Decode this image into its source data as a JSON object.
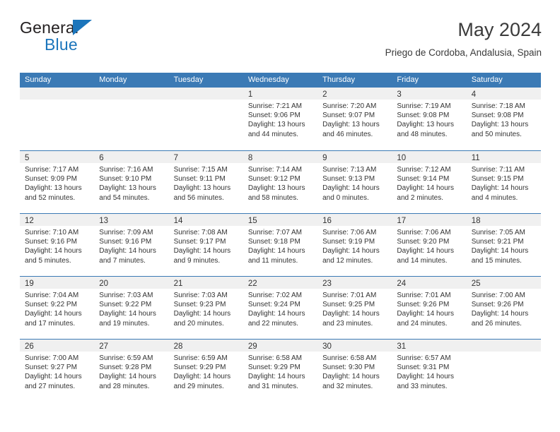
{
  "logo": {
    "word_top": "General",
    "word_bottom": "Blue",
    "triangle_color": "#1b75bb",
    "icon": "triangle-icon"
  },
  "header": {
    "title": "May 2024",
    "subtitle": "Priego de Cordoba, Andalusia, Spain"
  },
  "colors": {
    "header_blue": "#3b7ab5",
    "day_band_gray": "#f0f0f0",
    "text": "#333333",
    "brand_blue": "#1b75bb"
  },
  "weekdays": [
    "Sunday",
    "Monday",
    "Tuesday",
    "Wednesday",
    "Thursday",
    "Friday",
    "Saturday"
  ],
  "weeks": [
    [
      {
        "day": "",
        "sunrise": "",
        "sunset": "",
        "daylight1": "",
        "daylight2": ""
      },
      {
        "day": "",
        "sunrise": "",
        "sunset": "",
        "daylight1": "",
        "daylight2": ""
      },
      {
        "day": "",
        "sunrise": "",
        "sunset": "",
        "daylight1": "",
        "daylight2": ""
      },
      {
        "day": "1",
        "sunrise": "Sunrise: 7:21 AM",
        "sunset": "Sunset: 9:06 PM",
        "daylight1": "Daylight: 13 hours",
        "daylight2": "and 44 minutes."
      },
      {
        "day": "2",
        "sunrise": "Sunrise: 7:20 AM",
        "sunset": "Sunset: 9:07 PM",
        "daylight1": "Daylight: 13 hours",
        "daylight2": "and 46 minutes."
      },
      {
        "day": "3",
        "sunrise": "Sunrise: 7:19 AM",
        "sunset": "Sunset: 9:08 PM",
        "daylight1": "Daylight: 13 hours",
        "daylight2": "and 48 minutes."
      },
      {
        "day": "4",
        "sunrise": "Sunrise: 7:18 AM",
        "sunset": "Sunset: 9:08 PM",
        "daylight1": "Daylight: 13 hours",
        "daylight2": "and 50 minutes."
      }
    ],
    [
      {
        "day": "5",
        "sunrise": "Sunrise: 7:17 AM",
        "sunset": "Sunset: 9:09 PM",
        "daylight1": "Daylight: 13 hours",
        "daylight2": "and 52 minutes."
      },
      {
        "day": "6",
        "sunrise": "Sunrise: 7:16 AM",
        "sunset": "Sunset: 9:10 PM",
        "daylight1": "Daylight: 13 hours",
        "daylight2": "and 54 minutes."
      },
      {
        "day": "7",
        "sunrise": "Sunrise: 7:15 AM",
        "sunset": "Sunset: 9:11 PM",
        "daylight1": "Daylight: 13 hours",
        "daylight2": "and 56 minutes."
      },
      {
        "day": "8",
        "sunrise": "Sunrise: 7:14 AM",
        "sunset": "Sunset: 9:12 PM",
        "daylight1": "Daylight: 13 hours",
        "daylight2": "and 58 minutes."
      },
      {
        "day": "9",
        "sunrise": "Sunrise: 7:13 AM",
        "sunset": "Sunset: 9:13 PM",
        "daylight1": "Daylight: 14 hours",
        "daylight2": "and 0 minutes."
      },
      {
        "day": "10",
        "sunrise": "Sunrise: 7:12 AM",
        "sunset": "Sunset: 9:14 PM",
        "daylight1": "Daylight: 14 hours",
        "daylight2": "and 2 minutes."
      },
      {
        "day": "11",
        "sunrise": "Sunrise: 7:11 AM",
        "sunset": "Sunset: 9:15 PM",
        "daylight1": "Daylight: 14 hours",
        "daylight2": "and 4 minutes."
      }
    ],
    [
      {
        "day": "12",
        "sunrise": "Sunrise: 7:10 AM",
        "sunset": "Sunset: 9:16 PM",
        "daylight1": "Daylight: 14 hours",
        "daylight2": "and 5 minutes."
      },
      {
        "day": "13",
        "sunrise": "Sunrise: 7:09 AM",
        "sunset": "Sunset: 9:16 PM",
        "daylight1": "Daylight: 14 hours",
        "daylight2": "and 7 minutes."
      },
      {
        "day": "14",
        "sunrise": "Sunrise: 7:08 AM",
        "sunset": "Sunset: 9:17 PM",
        "daylight1": "Daylight: 14 hours",
        "daylight2": "and 9 minutes."
      },
      {
        "day": "15",
        "sunrise": "Sunrise: 7:07 AM",
        "sunset": "Sunset: 9:18 PM",
        "daylight1": "Daylight: 14 hours",
        "daylight2": "and 11 minutes."
      },
      {
        "day": "16",
        "sunrise": "Sunrise: 7:06 AM",
        "sunset": "Sunset: 9:19 PM",
        "daylight1": "Daylight: 14 hours",
        "daylight2": "and 12 minutes."
      },
      {
        "day": "17",
        "sunrise": "Sunrise: 7:06 AM",
        "sunset": "Sunset: 9:20 PM",
        "daylight1": "Daylight: 14 hours",
        "daylight2": "and 14 minutes."
      },
      {
        "day": "18",
        "sunrise": "Sunrise: 7:05 AM",
        "sunset": "Sunset: 9:21 PM",
        "daylight1": "Daylight: 14 hours",
        "daylight2": "and 15 minutes."
      }
    ],
    [
      {
        "day": "19",
        "sunrise": "Sunrise: 7:04 AM",
        "sunset": "Sunset: 9:22 PM",
        "daylight1": "Daylight: 14 hours",
        "daylight2": "and 17 minutes."
      },
      {
        "day": "20",
        "sunrise": "Sunrise: 7:03 AM",
        "sunset": "Sunset: 9:22 PM",
        "daylight1": "Daylight: 14 hours",
        "daylight2": "and 19 minutes."
      },
      {
        "day": "21",
        "sunrise": "Sunrise: 7:03 AM",
        "sunset": "Sunset: 9:23 PM",
        "daylight1": "Daylight: 14 hours",
        "daylight2": "and 20 minutes."
      },
      {
        "day": "22",
        "sunrise": "Sunrise: 7:02 AM",
        "sunset": "Sunset: 9:24 PM",
        "daylight1": "Daylight: 14 hours",
        "daylight2": "and 22 minutes."
      },
      {
        "day": "23",
        "sunrise": "Sunrise: 7:01 AM",
        "sunset": "Sunset: 9:25 PM",
        "daylight1": "Daylight: 14 hours",
        "daylight2": "and 23 minutes."
      },
      {
        "day": "24",
        "sunrise": "Sunrise: 7:01 AM",
        "sunset": "Sunset: 9:26 PM",
        "daylight1": "Daylight: 14 hours",
        "daylight2": "and 24 minutes."
      },
      {
        "day": "25",
        "sunrise": "Sunrise: 7:00 AM",
        "sunset": "Sunset: 9:26 PM",
        "daylight1": "Daylight: 14 hours",
        "daylight2": "and 26 minutes."
      }
    ],
    [
      {
        "day": "26",
        "sunrise": "Sunrise: 7:00 AM",
        "sunset": "Sunset: 9:27 PM",
        "daylight1": "Daylight: 14 hours",
        "daylight2": "and 27 minutes."
      },
      {
        "day": "27",
        "sunrise": "Sunrise: 6:59 AM",
        "sunset": "Sunset: 9:28 PM",
        "daylight1": "Daylight: 14 hours",
        "daylight2": "and 28 minutes."
      },
      {
        "day": "28",
        "sunrise": "Sunrise: 6:59 AM",
        "sunset": "Sunset: 9:29 PM",
        "daylight1": "Daylight: 14 hours",
        "daylight2": "and 29 minutes."
      },
      {
        "day": "29",
        "sunrise": "Sunrise: 6:58 AM",
        "sunset": "Sunset: 9:29 PM",
        "daylight1": "Daylight: 14 hours",
        "daylight2": "and 31 minutes."
      },
      {
        "day": "30",
        "sunrise": "Sunrise: 6:58 AM",
        "sunset": "Sunset: 9:30 PM",
        "daylight1": "Daylight: 14 hours",
        "daylight2": "and 32 minutes."
      },
      {
        "day": "31",
        "sunrise": "Sunrise: 6:57 AM",
        "sunset": "Sunset: 9:31 PM",
        "daylight1": "Daylight: 14 hours",
        "daylight2": "and 33 minutes."
      },
      {
        "day": "",
        "sunrise": "",
        "sunset": "",
        "daylight1": "",
        "daylight2": ""
      }
    ]
  ]
}
